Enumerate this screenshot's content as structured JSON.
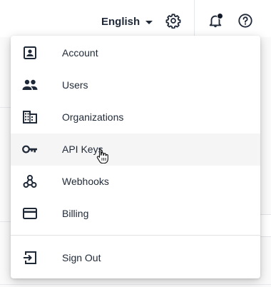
{
  "header": {
    "language_label": "English",
    "icons": {
      "settings": "gear-icon",
      "notifications": "bell-icon",
      "help": "help-circle-icon"
    }
  },
  "menu": {
    "items": [
      {
        "label": "Account",
        "icon": "account-box-icon"
      },
      {
        "label": "Users",
        "icon": "people-icon"
      },
      {
        "label": "Organizations",
        "icon": "building-icon"
      },
      {
        "label": "API Keys",
        "icon": "key-icon"
      },
      {
        "label": "Webhooks",
        "icon": "webhook-icon"
      },
      {
        "label": "Billing",
        "icon": "credit-card-icon"
      }
    ],
    "sign_out": {
      "label": "Sign Out",
      "icon": "logout-icon"
    }
  },
  "colors": {
    "text": "#1f2937",
    "hover_bg": "#f5f5f5",
    "divider": "#e2e2e2"
  }
}
